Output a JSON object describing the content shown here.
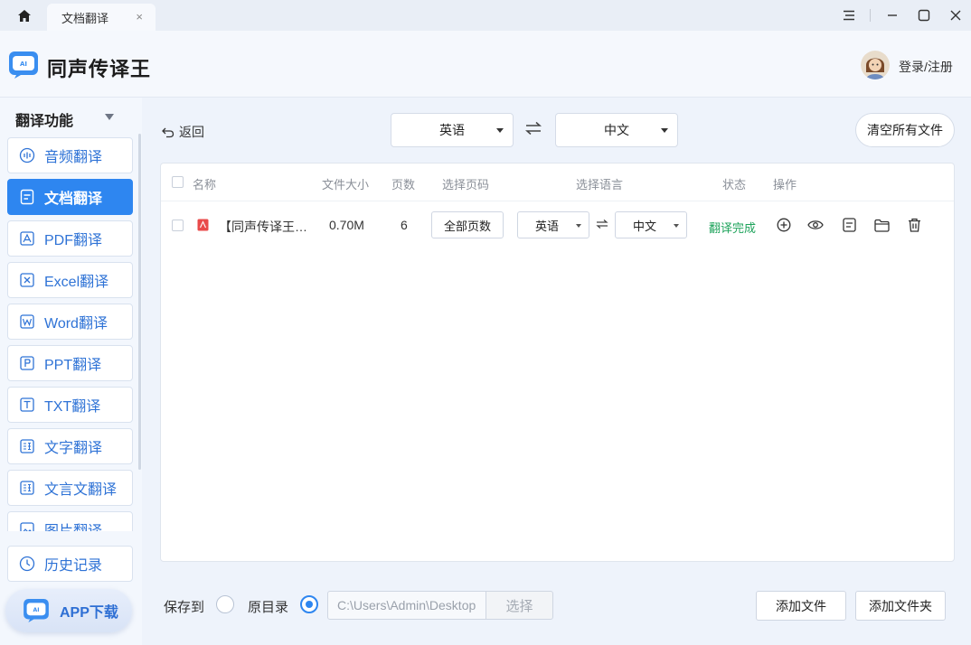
{
  "titlebar": {
    "tab_label": "文档翻译",
    "tab_close": "×"
  },
  "header": {
    "app_name": "同声传译王",
    "login": "登录/注册"
  },
  "sidebar": {
    "heading": "翻译功能",
    "items": [
      {
        "label": "音频翻译",
        "icon": "audio-icon"
      },
      {
        "label": "文档翻译",
        "icon": "document-icon",
        "active": true
      },
      {
        "label": "PDF翻译",
        "icon": "pdf-icon"
      },
      {
        "label": "Excel翻译",
        "icon": "excel-icon"
      },
      {
        "label": "Word翻译",
        "icon": "word-icon"
      },
      {
        "label": "PPT翻译",
        "icon": "ppt-icon"
      },
      {
        "label": "TXT翻译",
        "icon": "txt-icon"
      },
      {
        "label": "文字翻译",
        "icon": "text-translate-icon"
      },
      {
        "label": "文言文翻译",
        "icon": "classical-chinese-icon"
      },
      {
        "label": "图片翻译",
        "icon": "image-icon"
      }
    ],
    "history": "历史记录",
    "app_download": "APP下载"
  },
  "toolbar": {
    "back": "返回",
    "source_lang": "英语",
    "target_lang": "中文",
    "clear_all": "清空所有文件"
  },
  "table": {
    "columns": {
      "name": "名称",
      "size": "文件大小",
      "pages": "页数",
      "select_pages": "选择页码",
      "select_lang": "选择语言",
      "status": "状态",
      "actions": "操作"
    },
    "rows": [
      {
        "name": "【同声传译王…",
        "size": "0.70M",
        "pages": "6",
        "page_range": "全部页数",
        "source_lang": "英语",
        "target_lang": "中文",
        "status": "翻译完成"
      }
    ]
  },
  "bottom": {
    "save_to": "保存到",
    "original_dir": "原目录",
    "path": "C:\\Users\\Admin\\Desktop",
    "choose": "选择",
    "add_file": "添加文件",
    "add_folder": "添加文件夹"
  },
  "colors": {
    "accent": "#2e86f0",
    "success": "#1ea35b"
  }
}
